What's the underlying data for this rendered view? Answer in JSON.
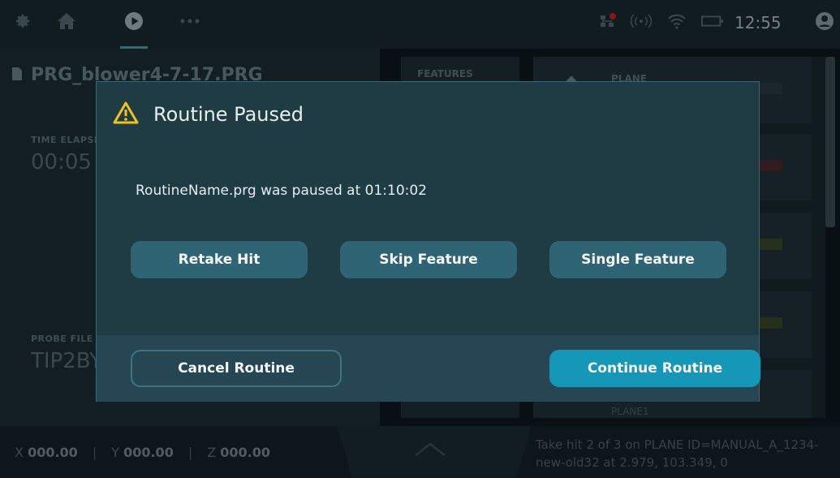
{
  "topbar": {
    "clock": "12:55",
    "icons": [
      "gear-icon",
      "home-icon",
      "play-icon",
      "more-icon",
      "network-alert-icon",
      "signal-icon",
      "wifi-icon",
      "battery-icon",
      "user-icon"
    ]
  },
  "background": {
    "file_name": "PRG_blower4-7-17.PRG",
    "time_elapsed_label": "TIME ELAPSED",
    "time_elapsed_value": "00:05",
    "probe_file_label": "PROBE FILE",
    "probe_file_value": "TIP2BY",
    "features_header": "FEATURES",
    "plane_header": "PLANE",
    "plane_item": "PLANE1"
  },
  "bottombar": {
    "x_label": "X",
    "x_value": "000.00",
    "y_label": "Y",
    "y_value": "000.00",
    "z_label": "Z",
    "z_value": "000.00",
    "separator": "|",
    "status_message": "Take  hit 2 of 3 on PLANE ID=MANUAL_A_1234-new-old32 at 2.979, 103.349, 0"
  },
  "modal": {
    "title": "Routine Paused",
    "message": "RoutineName.prg was paused at 01:10:02",
    "options": [
      "Retake Hit",
      "Skip Feature",
      "Single Feature"
    ],
    "cancel_label": "Cancel Routine",
    "continue_label": "Continue Routine"
  },
  "colors": {
    "accent": "#1597b8",
    "warning": "#f2c21b",
    "modal_bg": "#1f3b44",
    "option_button": "#2f6474"
  }
}
